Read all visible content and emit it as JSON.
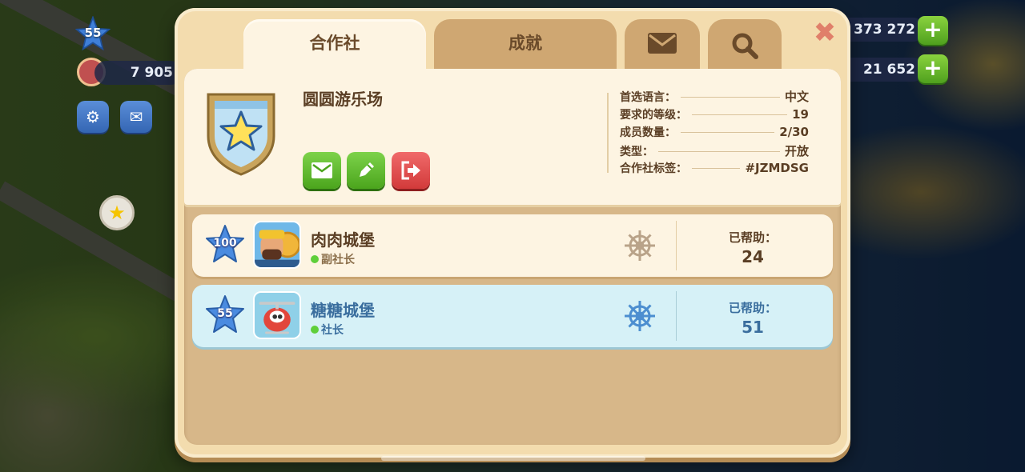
{
  "hud": {
    "level": "55",
    "population": "7 905",
    "coins": "373 272",
    "cash": "21 652",
    "plus_label": "+"
  },
  "tabs": {
    "club": "合作社",
    "achievements": "成就",
    "mail_icon": "envelope-icon",
    "search_icon": "magnifier-icon"
  },
  "close_label": "✖",
  "club": {
    "name": "圆圆游乐场",
    "badge_icon": "star-shield-icon",
    "stats": [
      {
        "label": "首选语言：",
        "value": "中文"
      },
      {
        "label": "要求的等级：",
        "value": "19"
      },
      {
        "label": "成员数量：",
        "value": "2/30"
      },
      {
        "label": "类型：",
        "value": "开放"
      },
      {
        "label": "合作社标签：",
        "value": "#JZMDSG"
      }
    ]
  },
  "members": [
    {
      "level": "100",
      "name": "肉肉城堡",
      "role": "副社长",
      "helped_label": "已帮助：",
      "helped": "24",
      "highlight": false
    },
    {
      "level": "55",
      "name": "糖糖城堡",
      "role": "社长",
      "helped_label": "已帮助：",
      "helped": "51",
      "highlight": true
    }
  ],
  "colors": {
    "modal_bg": "#f3dcae",
    "card_bg": "#fdf4e2",
    "highlight_row": "#d6f1f7",
    "green_button": "#4ba51d",
    "red_button": "#d23a3a",
    "text_brown": "#5a3e24",
    "text_blue": "#3a6e9e"
  }
}
